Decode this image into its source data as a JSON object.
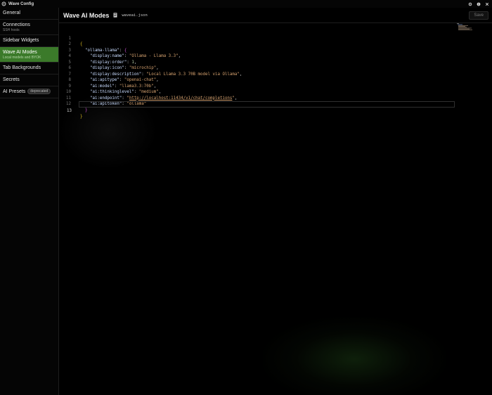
{
  "window": {
    "title": "Wave Config"
  },
  "sidebar": {
    "items": [
      {
        "label": "General",
        "sub": ""
      },
      {
        "label": "Connections",
        "sub": "SSH hosts"
      },
      {
        "label": "Sidebar Widgets",
        "sub": ""
      },
      {
        "label": "Wave AI Modes",
        "sub": "Local models and BYOK",
        "active": true
      },
      {
        "label": "Tab Backgrounds",
        "sub": ""
      },
      {
        "label": "Secrets",
        "sub": ""
      },
      {
        "label": "AI Presets",
        "sub": "",
        "badge": "deprecated"
      }
    ]
  },
  "header": {
    "title": "Wave AI Modes",
    "filename": "waveai.json",
    "save_label": "Save"
  },
  "editor": {
    "line_numbers": [
      "1",
      "2",
      "3",
      "4",
      "5",
      "6",
      "7",
      "8",
      "9",
      "10",
      "11",
      "12",
      "13"
    ],
    "lines": {
      "l2_key": "\"ollama-llama\"",
      "l3_key": "\"display:name\"",
      "l3_val": "\"Ollama - Llama 3.3\"",
      "l4_key": "\"display:order\"",
      "l4_val": "1",
      "l5_key": "\"display:icon\"",
      "l5_val": "\"microchip\"",
      "l6_key": "\"display:description\"",
      "l6_val": "\"Local Llama 3.3 70B model via Ollama\"",
      "l7_key": "\"ai:apitype\"",
      "l7_val": "\"openai-chat\"",
      "l8_key": "\"ai:model\"",
      "l8_val": "\"llama3.3:70b\"",
      "l9_key": "\"ai:thinkinglevel\"",
      "l9_val": "\"medium\"",
      "l10_key": "\"ai:endpoint\"",
      "l10_val_url": "http://localhost:11434/v1/chat/completions",
      "l11_key": "\"ai:apitoken\"",
      "l11_val": "\"ollama\""
    }
  },
  "colors": {
    "active_nav": "#3b7a2a",
    "string": "#d6a26f",
    "number": "#b5cea8",
    "key": "#c9dcff",
    "bracket_outer": "#e0c020",
    "bracket_inner": "#c84fd0"
  },
  "icons": [
    "wave-logo-icon",
    "gear-icon",
    "info-icon",
    "close-icon",
    "file-icon"
  ]
}
